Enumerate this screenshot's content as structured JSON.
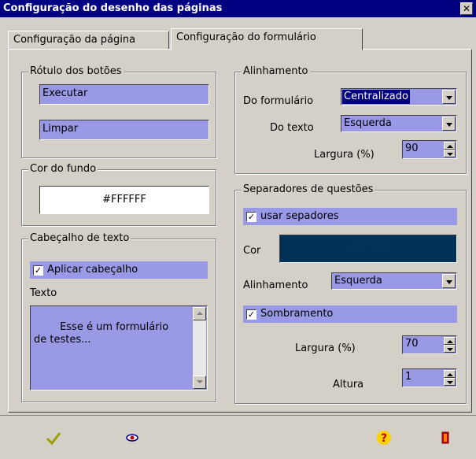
{
  "window": {
    "title": "Configuração do desenho das páginas",
    "close": "✕"
  },
  "tabs": [
    {
      "label": "Configuração da página"
    },
    {
      "label": "Configuração do formulário"
    }
  ],
  "button_labels": {
    "title": "Rótulo dos botões",
    "execute": "Executar",
    "clear": "Limpar"
  },
  "background": {
    "title": "Cor do fundo",
    "value": "#FFFFFF"
  },
  "header_text": {
    "title": "Cabeçalho de texto",
    "apply_label": "Aplicar cabeçalho",
    "apply_checked": "✓",
    "text_label": "Texto",
    "text_value": "Esse é um formulário\nde testes..."
  },
  "alignment": {
    "title": "Alinhamento",
    "form_label": "Do formulário",
    "form_value": "Centralizado",
    "text_label": "Do texto",
    "text_value": "Esquerda",
    "width_label": "Largura (%)",
    "width_value": "90"
  },
  "separators": {
    "title": "Separadores de questões",
    "use_label": "usar sepadores",
    "use_checked": "✓",
    "color_label": "Cor",
    "color_value": "#003157",
    "color_text_color": "#00345e",
    "align_label": "Alinhamento",
    "align_value": "Esquerda",
    "shading_label": "Sombramento",
    "shading_checked": "✓",
    "width_label": "Largura (%)",
    "width_value": "70",
    "height_label": "Altura",
    "height_value": "1"
  },
  "toolbar": {
    "ok_icon": "checkmark-icon",
    "preview_icon": "eye-icon",
    "help_icon": "help-icon",
    "exit_icon": "exit-door-icon"
  }
}
